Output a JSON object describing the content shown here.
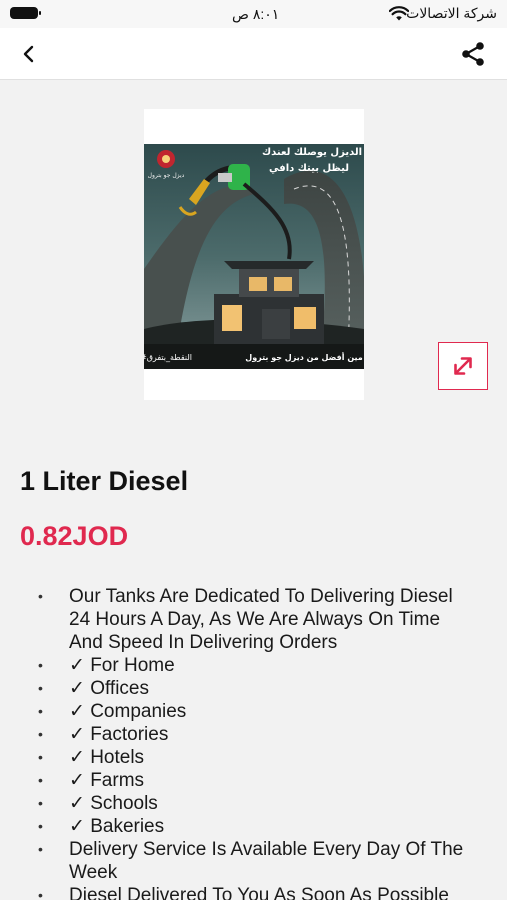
{
  "status_bar": {
    "carrier": "شركة الاتصالات",
    "time": "٨:٠١ ص",
    "icons": [
      "battery-icon",
      "wifi-icon"
    ]
  },
  "nav": {
    "back_icon": "chevron-left-icon",
    "share_icon": "share-icon"
  },
  "product_image": {
    "headline_line1": "الديزل يوصلك لعندك",
    "headline_line2": "ليظل بيتك دافي",
    "footer_left": "#النقطة_بتفرق",
    "footer_right": "مين أفضل من ديزل جو بترول"
  },
  "expand_icon": "expand-icon",
  "product": {
    "title": "1 Liter Diesel",
    "price": "0.82JOD",
    "accent_color": "#e0294f"
  },
  "features": [
    "Our Tanks Are Dedicated To Delivering Diesel 24 Hours A Day, As We Are Always On Time And Speed In Delivering Orders",
    "✓ For Home",
    "✓ Offices",
    "✓ Companies",
    "✓ Factories",
    "✓ Hotels",
    "✓ Farms",
    "✓ Schools",
    "✓ Bakeries",
    "Delivery Service Is Available Every Day Of The Week",
    "Diesel Delivered To You As Soon As Possible"
  ]
}
